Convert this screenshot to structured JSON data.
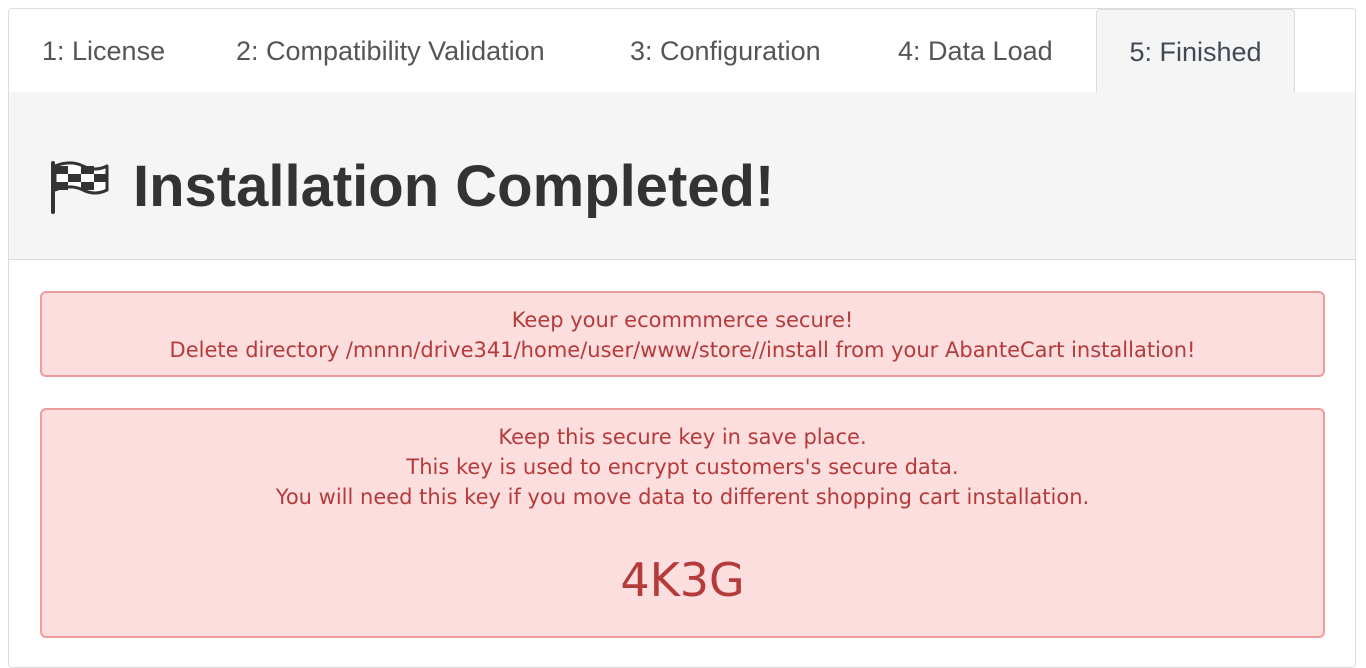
{
  "tabs": [
    {
      "label": "1: License",
      "active": false
    },
    {
      "label": "2: Compatibility Validation",
      "active": false
    },
    {
      "label": "3: Configuration",
      "active": false
    },
    {
      "label": "4: Data Load",
      "active": false
    },
    {
      "label": "5: Finished",
      "active": true
    }
  ],
  "header": {
    "icon": "checkered-flag-icon",
    "title": "Installation Completed!"
  },
  "alerts": {
    "secure_notice": {
      "line1": "Keep your ecommmerce secure!",
      "line2": "Delete directory /mnnn/drive341/home/user/www/store//install from your AbanteCart installation!"
    },
    "key_notice": {
      "line1": "Keep this secure key in save place.",
      "line2": "This key is used to encrypt customers's secure data.",
      "line3": "You will need this key if you move data to different shopping cart installation.",
      "key": "4K3G"
    }
  },
  "colors": {
    "alert_background": "#fddede",
    "alert_border": "#ee9b9b",
    "alert_text": "#b53a3a",
    "header_background": "#f5f5f5",
    "title_text": "#333333"
  }
}
